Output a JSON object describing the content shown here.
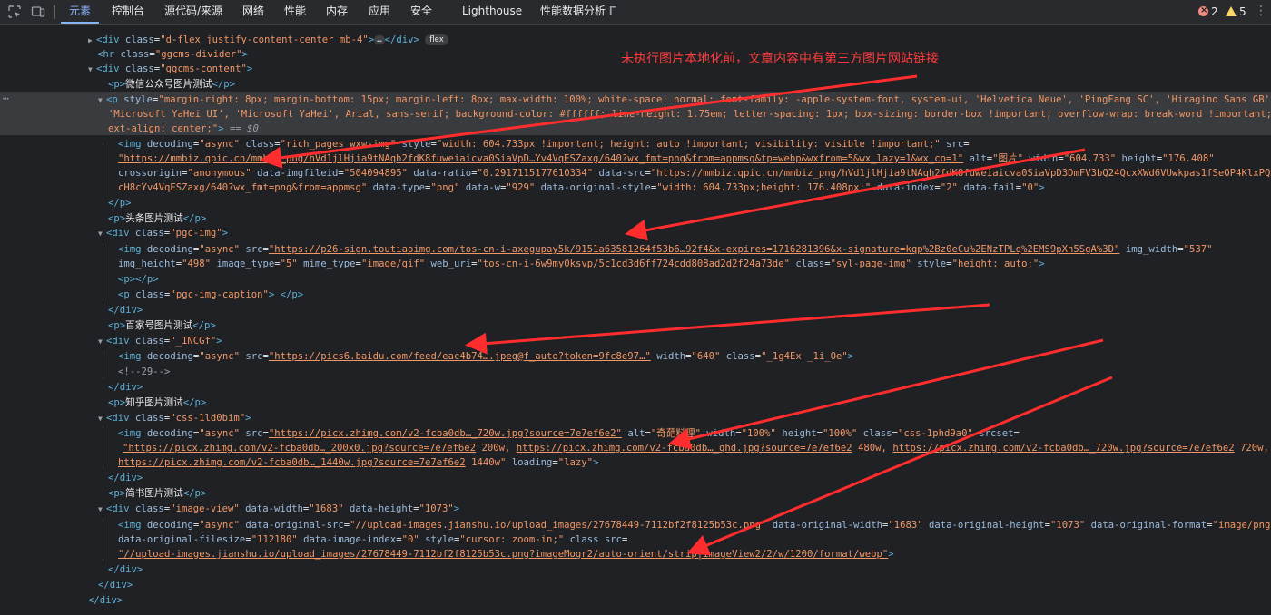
{
  "toolbar": {
    "tabs": [
      {
        "label": "元素",
        "active": true
      },
      {
        "label": "控制台"
      },
      {
        "label": "源代码/来源"
      },
      {
        "label": "网络"
      },
      {
        "label": "性能"
      },
      {
        "label": "内存"
      },
      {
        "label": "应用"
      },
      {
        "label": "安全"
      },
      {
        "label": "Lighthouse"
      },
      {
        "label": "性能数据分析"
      }
    ],
    "error_count": "2",
    "warning_count": "5"
  },
  "annotation": {
    "text": "未执行图片本地化前，文章内容中有第三方图片网站链接",
    "color": "#ff3b3b"
  },
  "dom": {
    "l0": {
      "tag": "<div",
      "attr": " class",
      "val": "\"d-flex justify-content-center mb-4\"",
      "rest": ">",
      "ell": "…",
      "close": "</div>",
      "pill": "flex"
    },
    "l1": {
      "tag": "<hr",
      "attr": " class",
      "val": "\"ggcms-divider\"",
      "rest": ">"
    },
    "l2": {
      "tag": "<div",
      "attr": " class",
      "val": "\"ggcms-content\"",
      "rest": ">"
    },
    "l3": {
      "open": "<p>",
      "text": "微信公众号图片测试",
      "close": "</p>"
    },
    "l4": {
      "tag": "<p",
      "attr": " style",
      "val": "\"margin-right: 8px; margin-bottom: 15px; margin-left: 8px; max-width: 100%; white-space: normal; font-family: -apple-system-font, system-ui, 'Helvetica Neue', 'PingFang SC', 'Hiragino Sans GB',"
    },
    "l5": {
      "val": "'Microsoft YaHei UI', 'Microsoft YaHei', Arial, sans-serif; background-color: #ffffff; line-height: 1.75em; letter-spacing: 1px; box-sizing: border-box !important; overflow-wrap: break-word !important; t"
    },
    "l6": {
      "val": "ext-align: center;\"",
      "rest": ">",
      "eq": " == $0"
    },
    "l7": {
      "tag": "<img",
      "a1": " decoding",
      "v1": "\"async\"",
      "a2": " class",
      "v2": "\"rich_pages wxw-img\"",
      "a3": " style",
      "v3": "\"width: 604.733px !important; height: auto !important; visibility: visible !important;\"",
      "a4": " src",
      "eq": "="
    },
    "l8": {
      "link": "\"https://mmbiz.qpic.cn/mmbiz_png/hVd1jlHjia9tNAqh2fdK8fuweiaicva0SiaVpD…Yv4VqESZaxg/640?wx_fmt=png&from=appmsg&tp=webp&wxfrom=5&wx_lazy=1&wx_co=1\"",
      "a1": " alt",
      "v1": "\"图片\"",
      "a2": " width",
      "v2": "\"604.733\"",
      "a3": " height",
      "v3": "\"176.408\""
    },
    "l9": {
      "a1": "crossorigin",
      "v1": "\"anonymous\"",
      "a2": " data-imgfileid",
      "v2": "\"504094895\"",
      "a3": " data-ratio",
      "v3": "\"0.2917115177610334\"",
      "a4": " data-src",
      "v4": "\"https://mmbiz.qpic.cn/mmbiz_png/hVd1jlHjia9tNAqh2fdK8fuweiaicva0SiaVpD3DmFV3bQ24QcxXWd6VUwkpas1fSeOP4KlxPQXi"
    },
    "l10": {
      "v1": "cH8cYv4VqESZaxg/640?wx_fmt=png&from=appmsg\"",
      "a2": " data-type",
      "v2": "\"png\"",
      "a3": " data-w",
      "v3": "\"929\"",
      "a4": " data-original-style",
      "v4": "\"width: 604.733px;height: 176.408px;\"",
      "a5": " data-index",
      "v5": "\"2\"",
      "a6": " data-fail",
      "v6": "\"0\"",
      "rest": ">"
    },
    "l11": {
      "close": "</p>"
    },
    "l12": {
      "open": "<p>",
      "text": "头条图片测试",
      "close": "</p>"
    },
    "l13": {
      "tag": "<div",
      "attr": " class",
      "val": "\"pgc-img\"",
      "rest": ">"
    },
    "l14": {
      "tag": "<img",
      "a1": " decoding",
      "v1": "\"async\"",
      "a2": " src",
      "link": "\"https://p26-sign.toutiaoimg.com/tos-cn-i-axegupay5k/9151a63581264f53b6…92f4&x-expires=1716281396&x-signature=kqp%2Bz0eCu%2ENzTPLq%2EMS9pXn5SgA%3D\"",
      "a3": " img_width",
      "v3": "\"537\""
    },
    "l15": {
      "a1": "img_height",
      "v1": "\"498\"",
      "a2": " image_type",
      "v2": "\"5\"",
      "a3": " mime_type",
      "v3": "\"image/gif\"",
      "a4": " web_uri",
      "v4": "\"tos-cn-i-6w9my0ksvp/5c1cd3d6ff724cdd808ad2d2f24a73de\"",
      "a5": " class",
      "v5": "\"syl-page-img\"",
      "a6": " style",
      "v6": "\"height: auto;\"",
      "rest": ">"
    },
    "l16": {
      "text": "<p></p>"
    },
    "l17": {
      "tag": "<p",
      "attr": " class",
      "val": "\"pgc-img-caption\"",
      "rest": "> </p>"
    },
    "l18": {
      "close": "</div>"
    },
    "l19": {
      "open": "<p>",
      "text": "百家号图片测试",
      "close": "</p>"
    },
    "l20": {
      "tag": "<div",
      "attr": " class",
      "val": "\"_1NCGf\"",
      "rest": ">"
    },
    "l21": {
      "tag": "<img",
      "a1": " decoding",
      "v1": "\"async\"",
      "a2": " src",
      "link": "\"https://pics6.baidu.com/feed/eac4b74….jpeg@f_auto?token=9fc8e97…\"",
      "a3": " width",
      "v3": "\"640\"",
      "a4": " class",
      "v4": "\"_1g4Ex _1i_Oe\"",
      "rest": ">"
    },
    "l22": {
      "text": "<!--29-->"
    },
    "l23": {
      "close": "</div>"
    },
    "l24": {
      "open": "<p>",
      "text": "知乎图片测试",
      "close": "</p>"
    },
    "l25": {
      "tag": "<div",
      "attr": " class",
      "val": "\"css-1ld0bim\"",
      "rest": ">"
    },
    "l26": {
      "tag": "<img",
      "a1": " decoding",
      "v1": "\"async\"",
      "a2": " src",
      "link": "\"https://picx.zhimg.com/v2-fcba0db…_720w.jpg?source=7e7ef6e2\"",
      "a3": " alt",
      "v3": "\"奇葩料理\"",
      "a4": " width",
      "v4": "\"100%\"",
      "a5": " height",
      "v5": "\"100%\"",
      "a6": " class",
      "v6": "\"css-1phd9a0\"",
      "a7": " srcset",
      "eq": "="
    },
    "l27": {
      "link1": "\"https://picx.zhimg.com/v2-fcba0db…_200x0.jpg?source=7e7ef6e2",
      "t1": " 200w, ",
      "link2": "https://picx.zhimg.com/v2-fcba0db…_qhd.jpg?source=7e7ef6e2",
      "t2": " 480w, ",
      "link3": "https://picx.zhimg.com/v2-fcba0db…_720w.jpg?source=7e7ef6e2",
      "t3": " 720w,"
    },
    "l28": {
      "link1": "https://picx.zhimg.com/v2-fcba0db…_1440w.jpg?source=7e7ef6e2",
      "t1": " 1440w\"",
      "a2": " loading",
      "v2": "\"lazy\"",
      "rest": ">"
    },
    "l29": {
      "close": "</div>"
    },
    "l30": {
      "open": "<p>",
      "text": "简书图片测试",
      "close": "</p>"
    },
    "l31": {
      "tag": "<div",
      "a1": " class",
      "v1": "\"image-view\"",
      "a2": " data-width",
      "v2": "\"1683\"",
      "a3": " data-height",
      "v3": "\"1073\"",
      "rest": ">"
    },
    "l32": {
      "tag": "<img",
      "a1": " decoding",
      "v1": "\"async\"",
      "a2": " data-original-src",
      "v2": "\"//upload-images.jianshu.io/upload_images/27678449-7112bf2f8125b53c.png\"",
      "a3": " data-original-width",
      "v3": "\"1683\"",
      "a4": " data-original-height",
      "v4": "\"1073\"",
      "a5": " data-original-format",
      "v5": "\"image/png\""
    },
    "l33": {
      "a1": "data-original-filesize",
      "v1": "\"112180\"",
      "a2": " data-image-index",
      "v2": "\"0\"",
      "a3": " style",
      "v3": "\"cursor: zoom-in;\"",
      "a4": " class",
      "a5": " src",
      "eq": "="
    },
    "l34": {
      "link": "\"//upload-images.jianshu.io/upload_images/27678449-7112bf2f8125b53c.png?imageMogr2/auto-orient/strip|imageView2/2/w/1200/format/webp\"",
      "rest": ">"
    },
    "l35": {
      "close": "</div>"
    },
    "l36": {
      "close": "</div>"
    },
    "l37": {
      "close": "</div>"
    }
  }
}
